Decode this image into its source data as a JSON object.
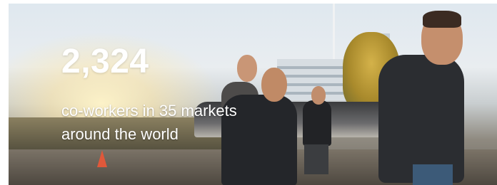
{
  "banner": {
    "stat_value": "2,324",
    "caption_line1": "co-workers in 35 markets",
    "caption_line2": "around the world"
  }
}
